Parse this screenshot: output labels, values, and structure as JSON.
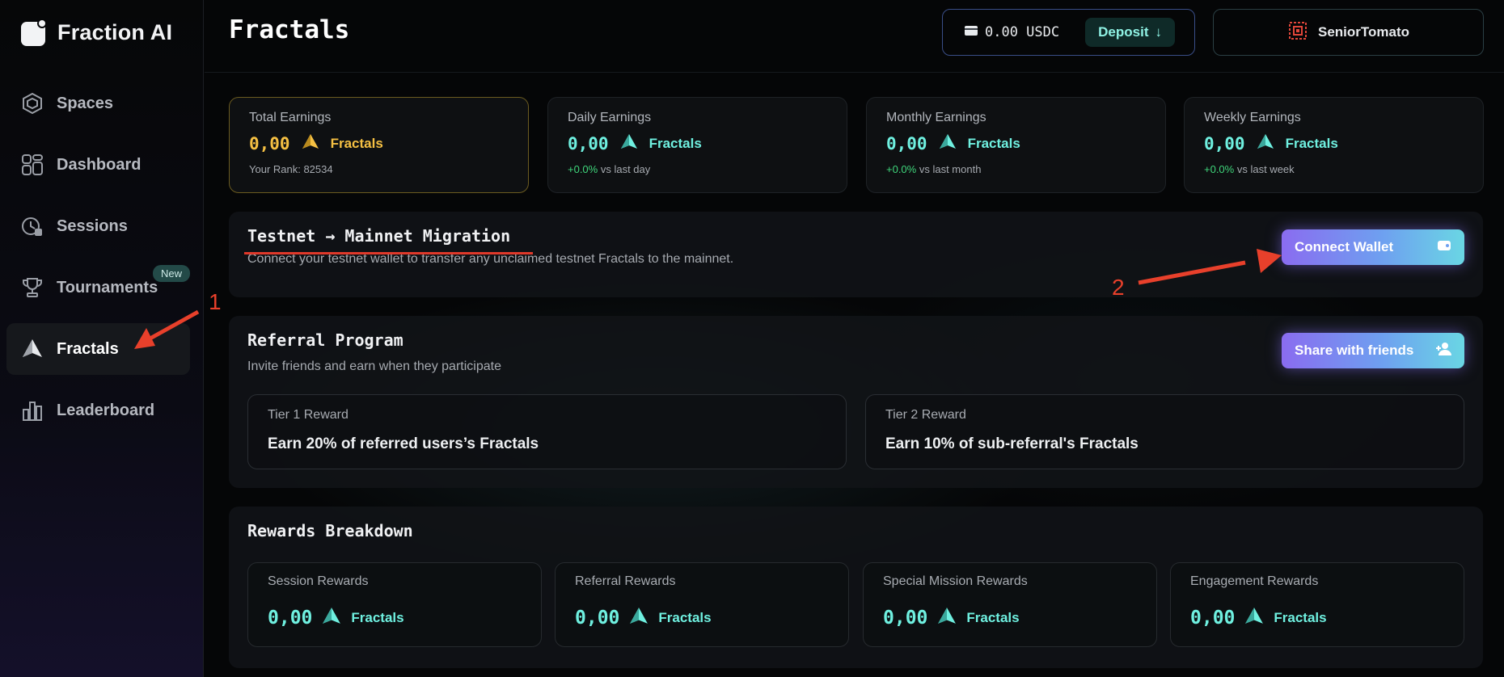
{
  "app": {
    "name": "Fraction AI"
  },
  "sidebar": {
    "items": [
      {
        "label": "Spaces",
        "icon": "spaces-icon"
      },
      {
        "label": "Dashboard",
        "icon": "dashboard-icon"
      },
      {
        "label": "Sessions",
        "icon": "sessions-icon"
      },
      {
        "label": "Tournaments",
        "icon": "trophy-icon",
        "badge": "New"
      },
      {
        "label": "Fractals",
        "icon": "fractals-icon",
        "active": true
      },
      {
        "label": "Leaderboard",
        "icon": "leaderboard-icon"
      }
    ]
  },
  "header": {
    "title": "Fractals",
    "wallet_balance": "0.00 USDC",
    "deposit_label": "Deposit",
    "username": "SeniorTomato"
  },
  "stats": [
    {
      "label": "Total Earnings",
      "value": "0,00",
      "unit": "Fractals",
      "sub": "Your Rank: 82534"
    },
    {
      "label": "Daily Earnings",
      "value": "0,00",
      "unit": "Fractals",
      "pct": "+0.0%",
      "sub": " vs last day"
    },
    {
      "label": "Monthly Earnings",
      "value": "0,00",
      "unit": "Fractals",
      "pct": "+0.0%",
      "sub": " vs last month"
    },
    {
      "label": "Weekly Earnings",
      "value": "0,00",
      "unit": "Fractals",
      "pct": "+0.0%",
      "sub": " vs last week"
    }
  ],
  "migration": {
    "title": "Testnet → Mainnet Migration",
    "desc": "Connect your testnet wallet to transfer any unclaimed testnet Fractals to the mainnet.",
    "button": "Connect Wallet"
  },
  "referral": {
    "title": "Referral Program",
    "desc": "Invite friends and earn when they participate",
    "button": "Share with friends",
    "tiers": [
      {
        "label": "Tier 1 Reward",
        "value": "Earn 20% of referred users’s Fractals"
      },
      {
        "label": "Tier 2 Reward",
        "value": "Earn 10% of sub-referral's Fractals"
      }
    ]
  },
  "rewards": {
    "title": "Rewards Breakdown",
    "items": [
      {
        "label": "Session Rewards",
        "value": "0,00",
        "unit": "Fractals"
      },
      {
        "label": "Referral Rewards",
        "value": "0,00",
        "unit": "Fractals"
      },
      {
        "label": "Special Mission Rewards",
        "value": "0,00",
        "unit": "Fractals"
      },
      {
        "label": "Engagement Rewards",
        "value": "0,00",
        "unit": "Fractals"
      }
    ]
  },
  "annotations": {
    "one": "1",
    "two": "2"
  },
  "colors": {
    "accent": "#6ff0e0",
    "gold": "#f5c043",
    "annotation": "#e8402b"
  }
}
